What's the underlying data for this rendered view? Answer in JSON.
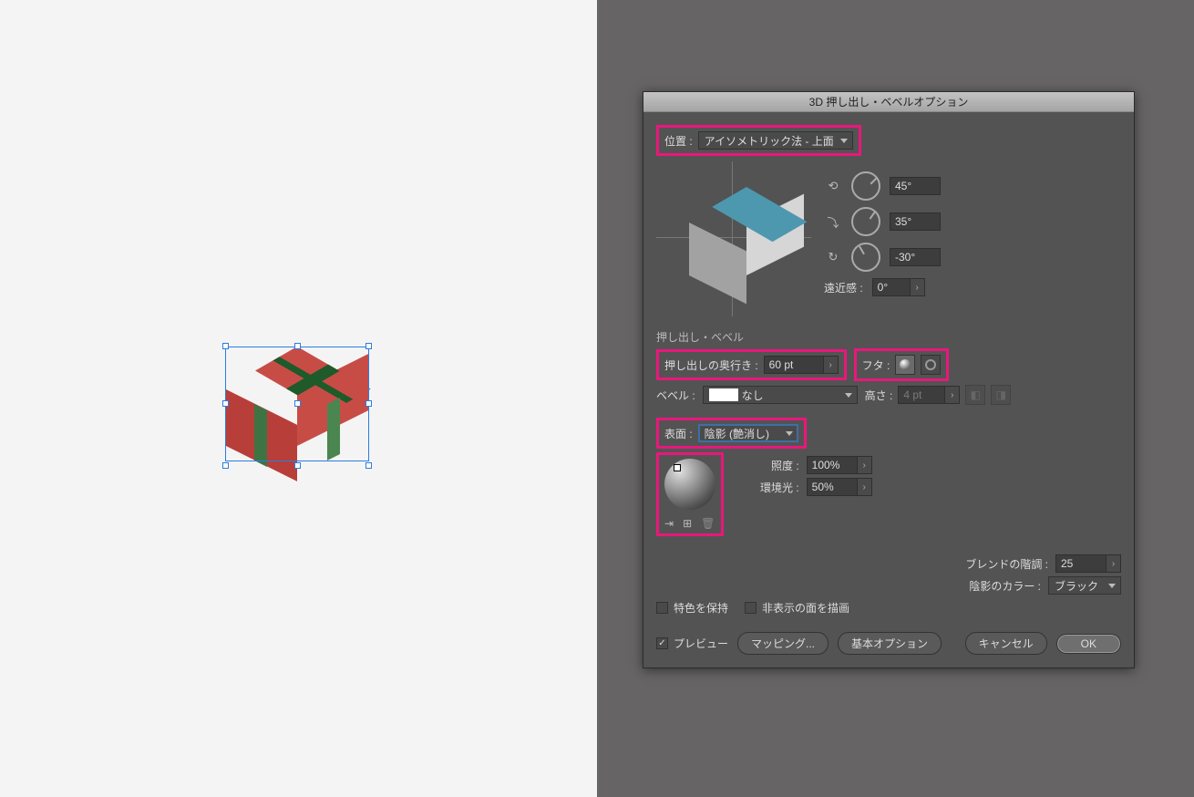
{
  "dialog": {
    "title": "3D 押し出し・ベベルオプション",
    "position": {
      "label": "位置 :",
      "value": "アイソメトリック法 - 上面"
    },
    "rotation": {
      "x": {
        "value": "45°"
      },
      "y": {
        "value": "35°"
      },
      "z": {
        "value": "-30°"
      },
      "perspective": {
        "label": "遠近感 :",
        "value": "0°"
      }
    },
    "extrude_section": {
      "heading": "押し出し・ベベル"
    },
    "extrude_depth": {
      "label": "押し出しの奥行き :",
      "value": "60 pt"
    },
    "cap": {
      "label": "フタ :"
    },
    "bevel": {
      "label": "ベベル :",
      "value": "なし"
    },
    "bevel_height": {
      "label": "高さ :",
      "value": "4 pt"
    },
    "surface": {
      "label": "表面 :",
      "value": "陰影 (艶消し)"
    },
    "light": {
      "intensity": {
        "label": "照度 :",
        "value": "100%"
      },
      "ambient": {
        "label": "環境光 :",
        "value": "50%"
      }
    },
    "blend_steps": {
      "label": "ブレンドの階調 :",
      "value": "25"
    },
    "shade_color": {
      "label": "陰影のカラー :",
      "value": "ブラック"
    },
    "preserve_spot": {
      "label": "特色を保持"
    },
    "hidden_faces": {
      "label": "非表示の面を描画"
    },
    "preview": {
      "label": "プレビュー"
    },
    "buttons": {
      "map": "マッピング...",
      "more": "基本オプション",
      "cancel": "キャンセル",
      "ok": "OK"
    }
  },
  "accent": "#e9177b"
}
